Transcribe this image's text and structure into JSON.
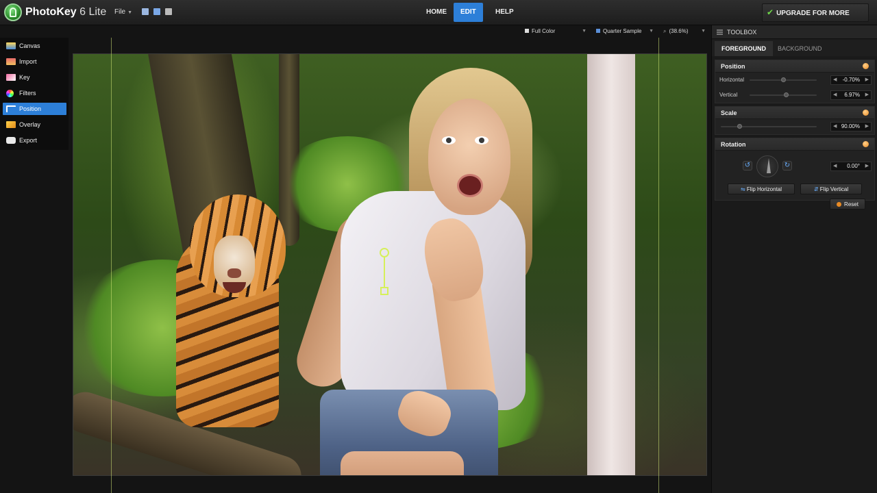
{
  "app": {
    "title": "PhotoKey",
    "version": "6 Lite",
    "file_menu": "File",
    "nav": [
      "HOME",
      "EDIT",
      "HELP"
    ],
    "nav_active": "EDIT",
    "upgrade_label": "UPGRADE FOR MORE FEATURES"
  },
  "options": {
    "color_mode": "Full Color",
    "sample_mode": "Quarter Sample",
    "zoom": "(38.6%)"
  },
  "sidebar": {
    "items": [
      {
        "label": "Canvas",
        "icon": "canvas-icon"
      },
      {
        "label": "Import",
        "icon": "import-icon"
      },
      {
        "label": "Key",
        "icon": "key-icon"
      },
      {
        "label": "Filters",
        "icon": "filters-icon"
      },
      {
        "label": "Position",
        "icon": "position-icon",
        "active": true
      },
      {
        "label": "Overlay",
        "icon": "overlay-icon"
      },
      {
        "label": "Export",
        "icon": "export-icon"
      }
    ]
  },
  "toolbox": {
    "title": "TOOLBOX",
    "tabs": [
      "FOREGROUND",
      "BACKGROUND"
    ],
    "active_tab": "FOREGROUND",
    "position": {
      "title": "Position",
      "horizontal_label": "Horizontal",
      "horizontal_value": "-0.70%",
      "vertical_label": "Vertical",
      "vertical_value": "6.97%"
    },
    "scale": {
      "title": "Scale",
      "value": "90.00%"
    },
    "rotation": {
      "title": "Rotation",
      "value": "0.00°",
      "flip_horizontal": "Flip Horizontal",
      "flip_vertical": "Flip Vertical",
      "reset": "Reset"
    }
  },
  "colors": {
    "accent": "#2d7fd8",
    "upgrade_check": "#6fd84a",
    "handle": "#d6f05a",
    "reset_dot": "#e88a24"
  }
}
